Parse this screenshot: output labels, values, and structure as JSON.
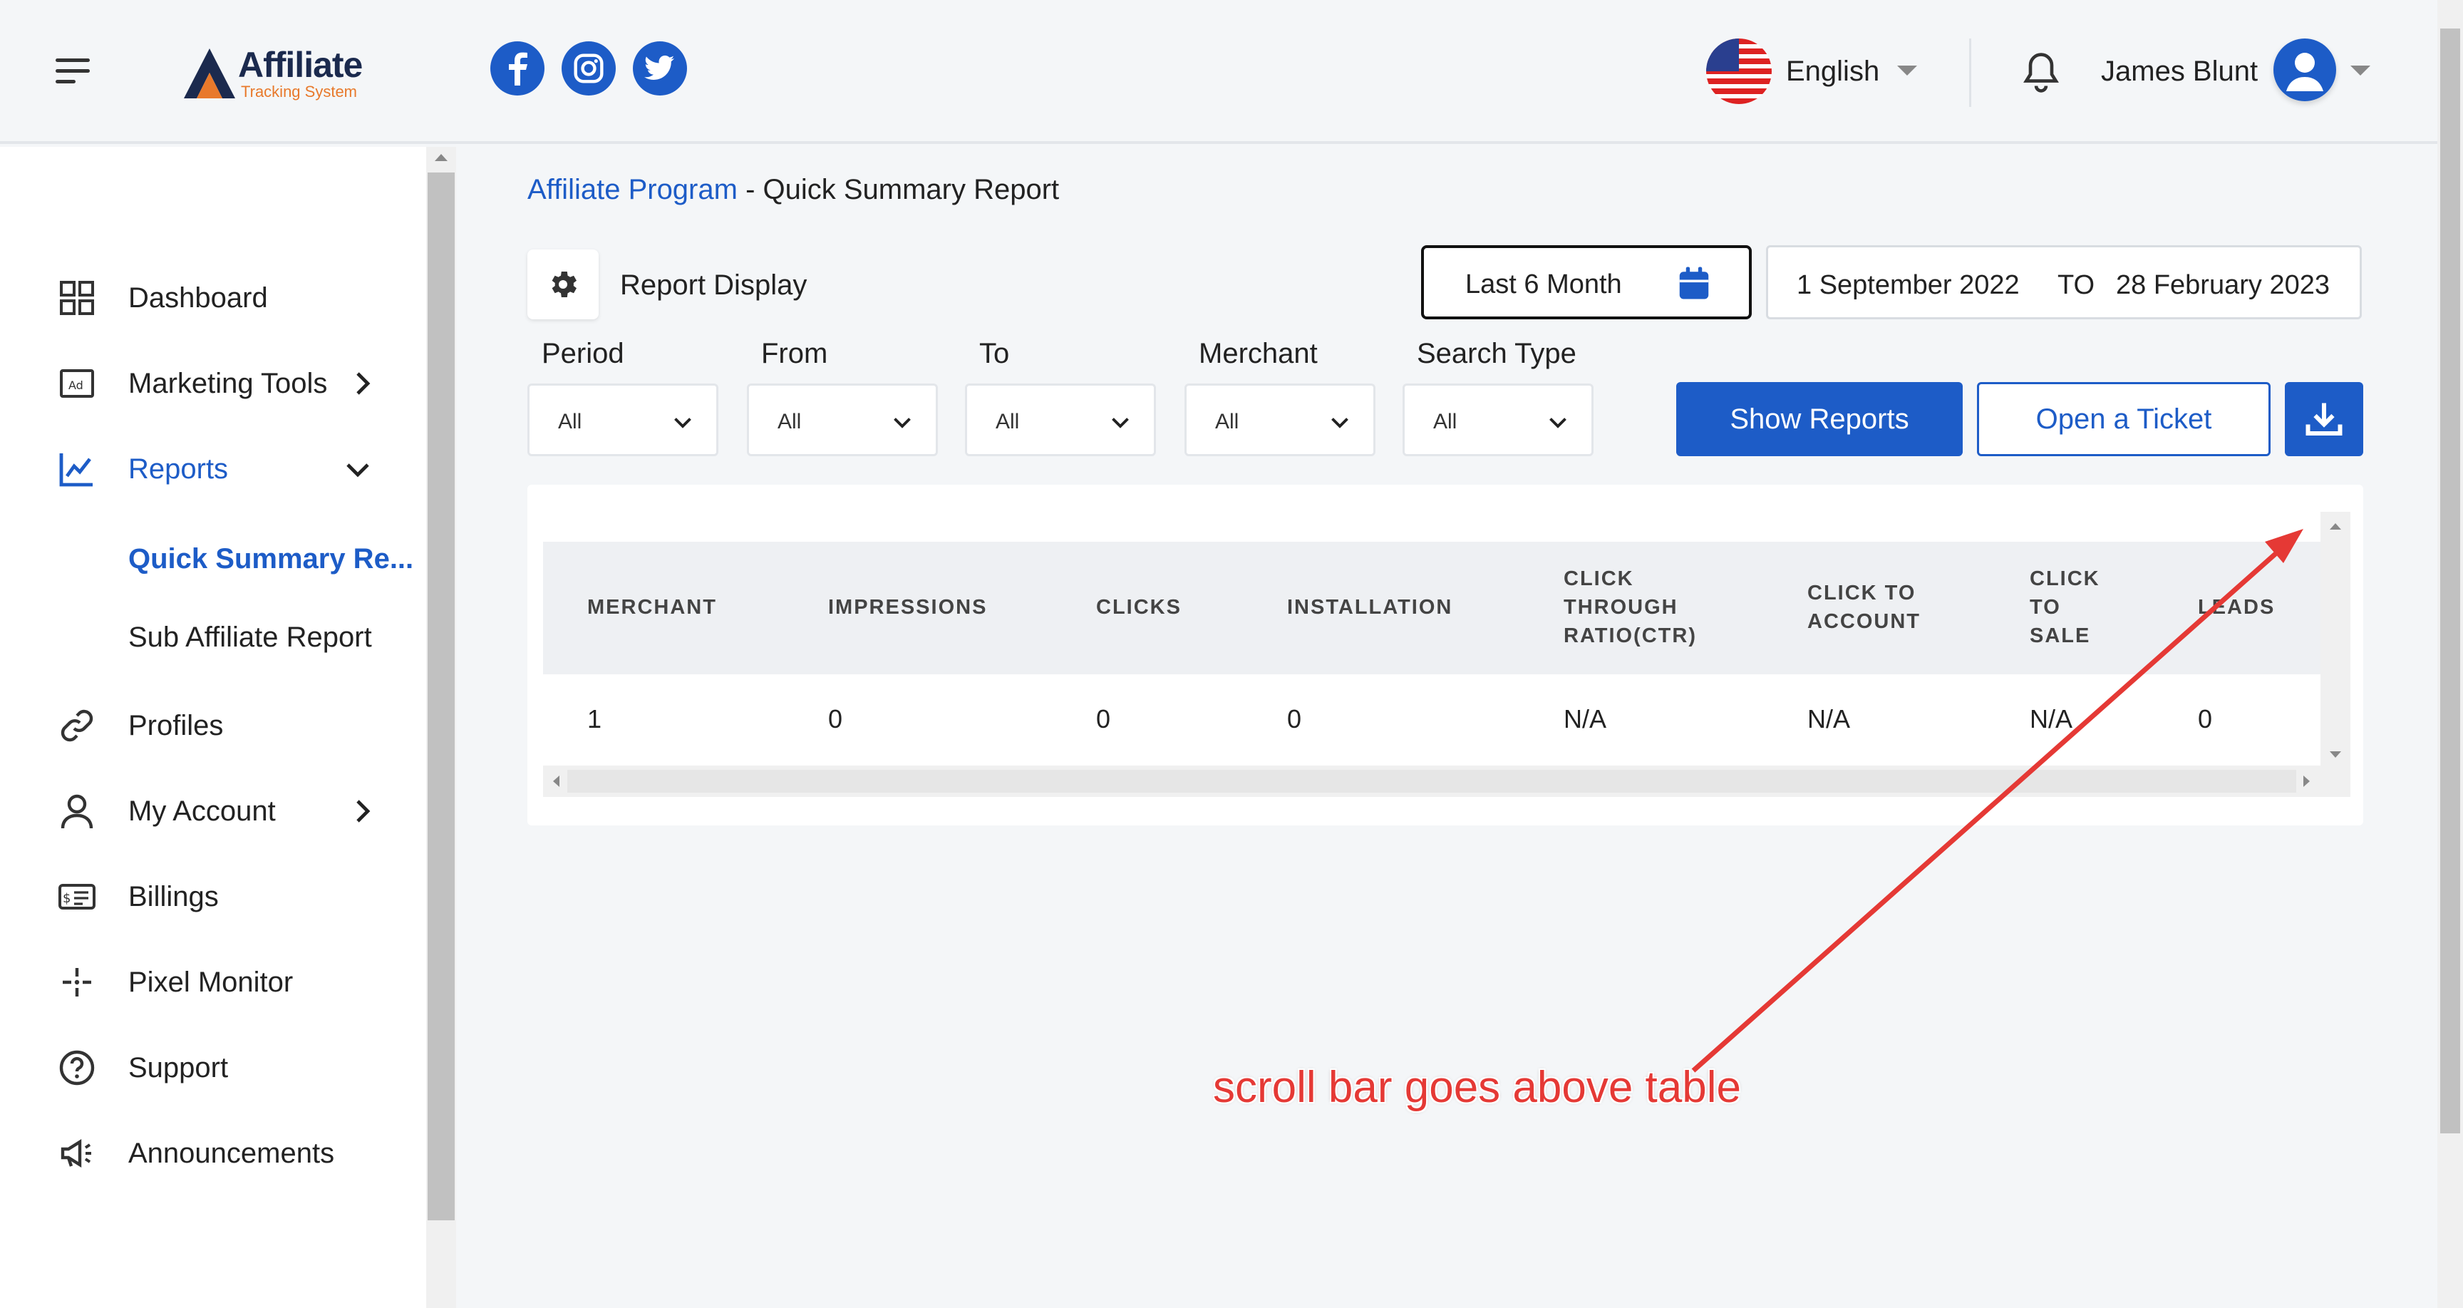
{
  "header": {
    "logo_text": "Affiliate",
    "logo_subtext": "Tracking System",
    "social": [
      "facebook-icon",
      "instagram-icon",
      "twitter-icon"
    ],
    "language": "English",
    "user_name": "James Blunt"
  },
  "sidebar": {
    "items": [
      {
        "label": "Dashboard",
        "icon": "dashboard-icon"
      },
      {
        "label": "Marketing Tools",
        "icon": "ad-icon"
      },
      {
        "label": "Reports",
        "icon": "chart-line-icon"
      },
      {
        "label": "Profiles",
        "icon": "link-icon"
      },
      {
        "label": "My Account",
        "icon": "user-icon"
      },
      {
        "label": "Billings",
        "icon": "billing-icon"
      },
      {
        "label": "Pixel Monitor",
        "icon": "pixel-icon"
      },
      {
        "label": "Support",
        "icon": "help-icon"
      },
      {
        "label": "Announcements",
        "icon": "megaphone-icon"
      }
    ],
    "reports_sub": [
      "Quick Summary Re...",
      "Sub Affiliate Report"
    ]
  },
  "breadcrumb": {
    "link": "Affiliate Program",
    "separator": " - ",
    "current": "Quick Summary Report"
  },
  "toolbar": {
    "report_display": "Report Display",
    "period_button": "Last 6 Month",
    "date_from": "1 September 2022",
    "date_to_label": "TO",
    "date_to": "28 February 2023"
  },
  "filters": [
    {
      "label": "Period",
      "value": "All"
    },
    {
      "label": "From",
      "value": "All"
    },
    {
      "label": "To",
      "value": "All"
    },
    {
      "label": "Merchant",
      "value": "All"
    },
    {
      "label": "Search Type",
      "value": "All"
    }
  ],
  "actions": {
    "show_reports": "Show Reports",
    "open_ticket": "Open a Ticket"
  },
  "table": {
    "headers": [
      [
        "MERCHANT"
      ],
      [
        "IMPRESSIONS"
      ],
      [
        "CLICKS"
      ],
      [
        "INSTALLATION"
      ],
      [
        "CLICK",
        "THROUGH",
        "RATIO(CTR)"
      ],
      [
        "CLICK TO",
        "ACCOUNT"
      ],
      [
        "CLICK",
        "TO",
        "SALE"
      ],
      [
        "LEADS"
      ]
    ],
    "rows": [
      [
        "1",
        "0",
        "0",
        "0",
        "N/A",
        "N/A",
        "N/A",
        "0"
      ]
    ]
  },
  "annotation": {
    "text": "scroll bar goes above table",
    "color": "#e53935"
  },
  "colors": {
    "primary": "#1d5cc7",
    "logo_orange": "#e8792b",
    "logo_navy": "#1b2a4e"
  }
}
